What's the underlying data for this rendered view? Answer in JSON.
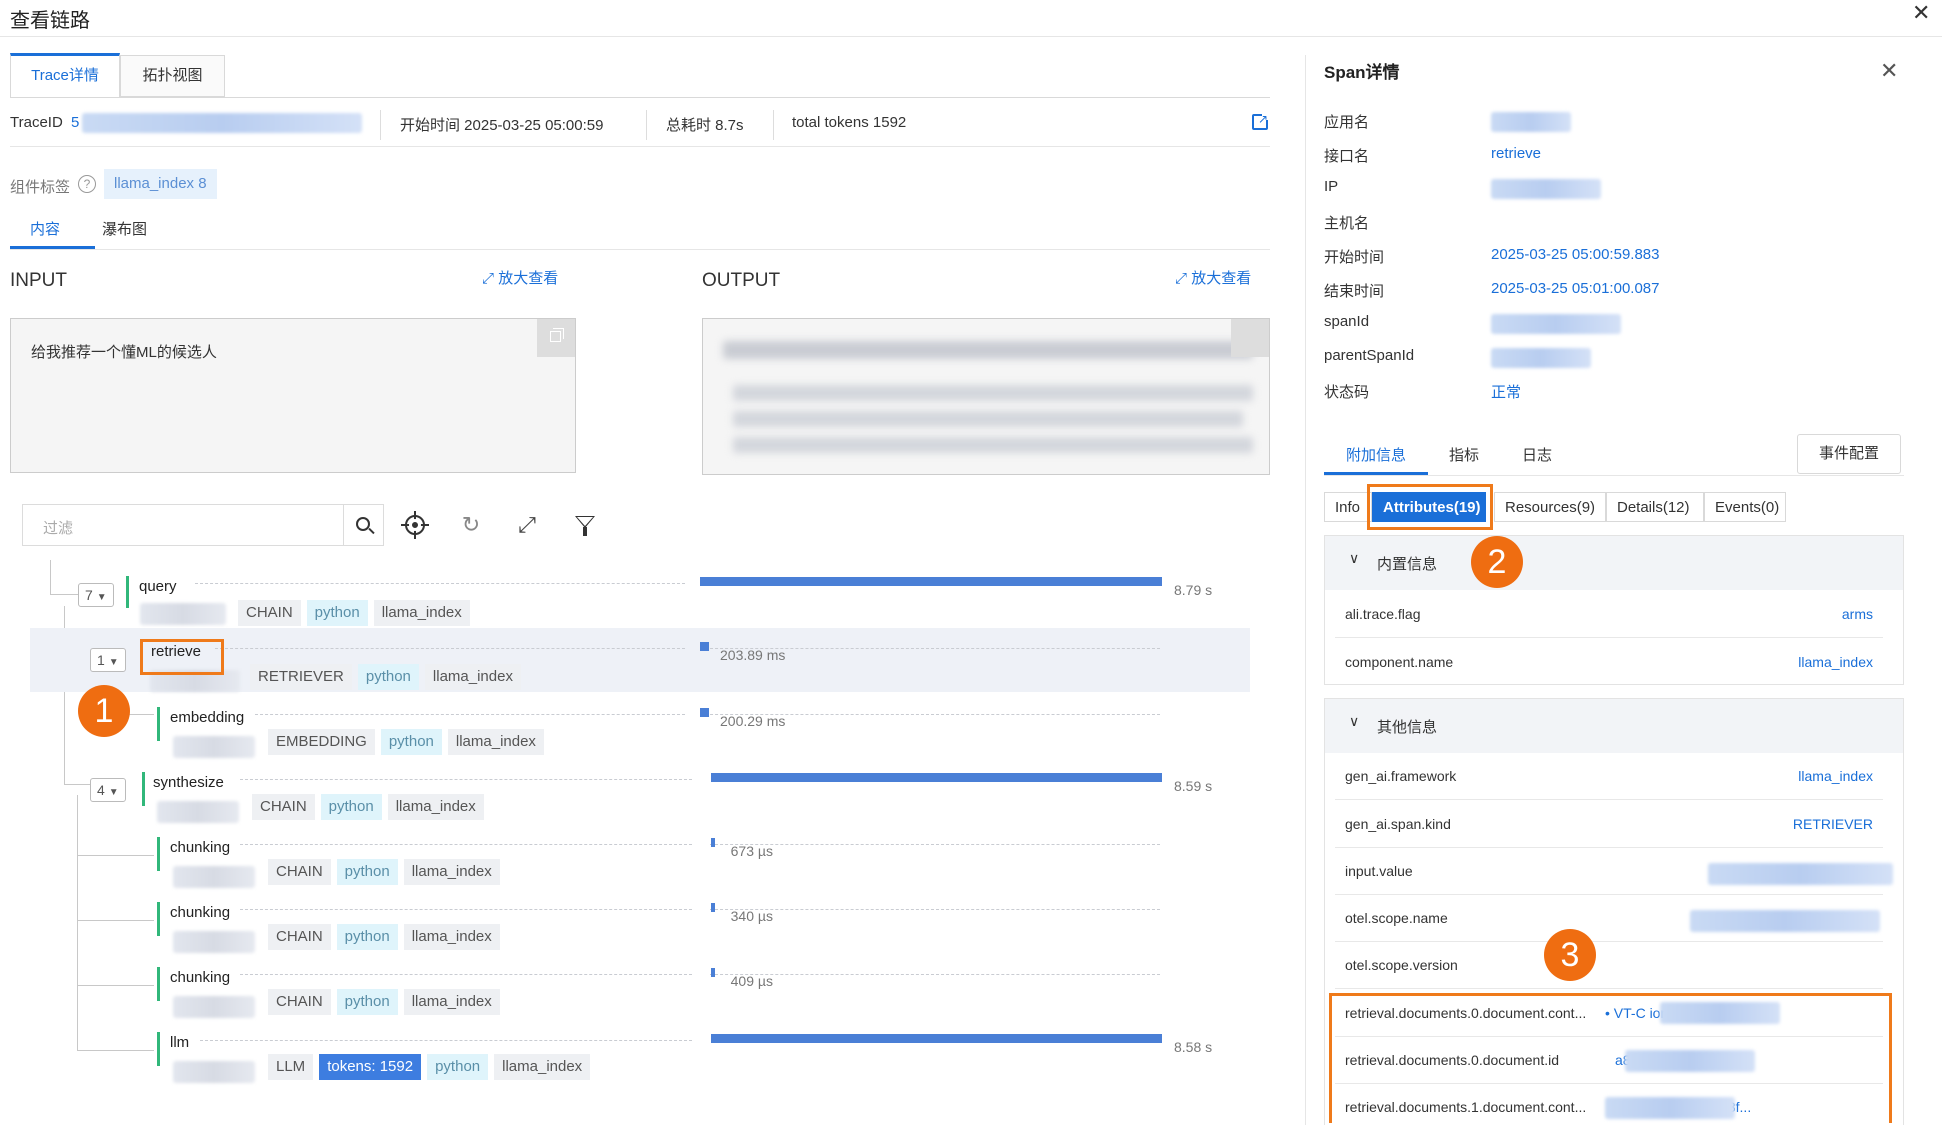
{
  "window": {
    "title": "查看链路"
  },
  "tabs": [
    {
      "label": "Trace详情",
      "active": true
    },
    {
      "label": "拓扑视图",
      "active": false
    }
  ],
  "trace_info": {
    "traceid_label": "TraceID",
    "traceid_prefix": "5",
    "start_time": "开始时间 2025-03-25 05:00:59",
    "total_duration": "总耗时 8.7s",
    "total_tokens": "total tokens 1592"
  },
  "component_tags": {
    "label": "组件标签",
    "tag": "llama_index 8"
  },
  "sub_tabs": [
    {
      "label": "内容",
      "active": true
    },
    {
      "label": "瀑布图",
      "active": false
    }
  ],
  "input": {
    "title": "INPUT",
    "zoom": "放大查看",
    "text": "给我推荐一个懂ML的候选人"
  },
  "output": {
    "title": "OUTPUT",
    "zoom": "放大查看"
  },
  "filter": {
    "placeholder": "过滤"
  },
  "spans": [
    {
      "name": "query",
      "count": "7",
      "tags": [
        "CHAIN",
        "python",
        "llama_index"
      ],
      "duration": "8.79 s",
      "bar_start": 0.0,
      "bar_fraction": 1.0
    },
    {
      "name": "retrieve",
      "count": "1",
      "tags": [
        "RETRIEVER",
        "python",
        "llama_index"
      ],
      "duration": "203.89 ms",
      "bar_start": 0.0,
      "bar_fraction": 0.023
    },
    {
      "name": "embedding",
      "count": "",
      "tags": [
        "EMBEDDING",
        "python",
        "llama_index"
      ],
      "duration": "200.29 ms",
      "bar_start": 0.0,
      "bar_fraction": 0.023
    },
    {
      "name": "synthesize",
      "count": "4",
      "tags": [
        "CHAIN",
        "python",
        "llama_index"
      ],
      "duration": "8.59 s",
      "bar_start": 0.023,
      "bar_fraction": 0.977
    },
    {
      "name": "chunking",
      "count": "",
      "tags": [
        "CHAIN",
        "python",
        "llama_index"
      ],
      "duration": "673 µs",
      "bar_start": 0.023,
      "bar_fraction": 0.001
    },
    {
      "name": "chunking",
      "count": "",
      "tags": [
        "CHAIN",
        "python",
        "llama_index"
      ],
      "duration": "340 µs",
      "bar_start": 0.023,
      "bar_fraction": 0.001
    },
    {
      "name": "chunking",
      "count": "",
      "tags": [
        "CHAIN",
        "python",
        "llama_index"
      ],
      "duration": "409 µs",
      "bar_start": 0.023,
      "bar_fraction": 0.001
    },
    {
      "name": "llm",
      "count": "",
      "tags": [
        "LLM",
        "tokens: 1592",
        "python",
        "llama_index"
      ],
      "duration": "8.58 s",
      "bar_start": 0.024,
      "bar_fraction": 0.976
    }
  ],
  "span_detail": {
    "title": "Span详情",
    "fields": [
      {
        "label": "应用名",
        "value": ""
      },
      {
        "label": "接口名",
        "value": "retrieve"
      },
      {
        "label": "IP",
        "value": ""
      },
      {
        "label": "主机名",
        "value": ""
      },
      {
        "label": "开始时间",
        "value": "2025-03-25 05:00:59.883"
      },
      {
        "label": "结束时间",
        "value": "2025-03-25 05:01:00.087"
      },
      {
        "label": "spanId",
        "value": ""
      },
      {
        "label": "parentSpanId",
        "value": ""
      },
      {
        "label": "状态码",
        "value": "正常"
      }
    ],
    "tabs": [
      {
        "label": "附加信息",
        "active": true
      },
      {
        "label": "指标",
        "active": false
      },
      {
        "label": "日志",
        "active": false
      }
    ],
    "event_config": "事件配置",
    "attr_tabs": [
      "Info",
      "Attributes(19)",
      "Resources(9)",
      "Details(12)",
      "Events(0)"
    ],
    "builtin_section": "内置信息",
    "builtin": [
      {
        "key": "ali.trace.flag",
        "value": "arms"
      },
      {
        "key": "component.name",
        "value": "llama_index"
      }
    ],
    "other_section": "其他信息",
    "other": [
      {
        "key": "gen_ai.framework",
        "value": "llama_index"
      },
      {
        "key": "gen_ai.span.kind",
        "value": "RETRIEVER"
      },
      {
        "key": "input.value",
        "value": "给我"
      },
      {
        "key": "otel.scope.name",
        "value": "aliyun."
      },
      {
        "key": "otel.scope.version",
        "value": ""
      },
      {
        "key": "retrieval.documents.0.document.cont...",
        "value": "• VT-C                         ion-Languag..."
      },
      {
        "key": "retrieval.documents.0.document.id",
        "value": "a8                              6c1d180d5feea..."
      },
      {
        "key": "retrieval.documents.1.document.cont...",
        "value": "Re                   2c2c6219a0c33f..."
      }
    ]
  },
  "badges": [
    "1",
    "2",
    "3"
  ],
  "colors": {
    "accent": "#1a6fd8",
    "highlight": "#ef7a1a",
    "bar": "#4a7fd6",
    "green": "#31b77a"
  }
}
